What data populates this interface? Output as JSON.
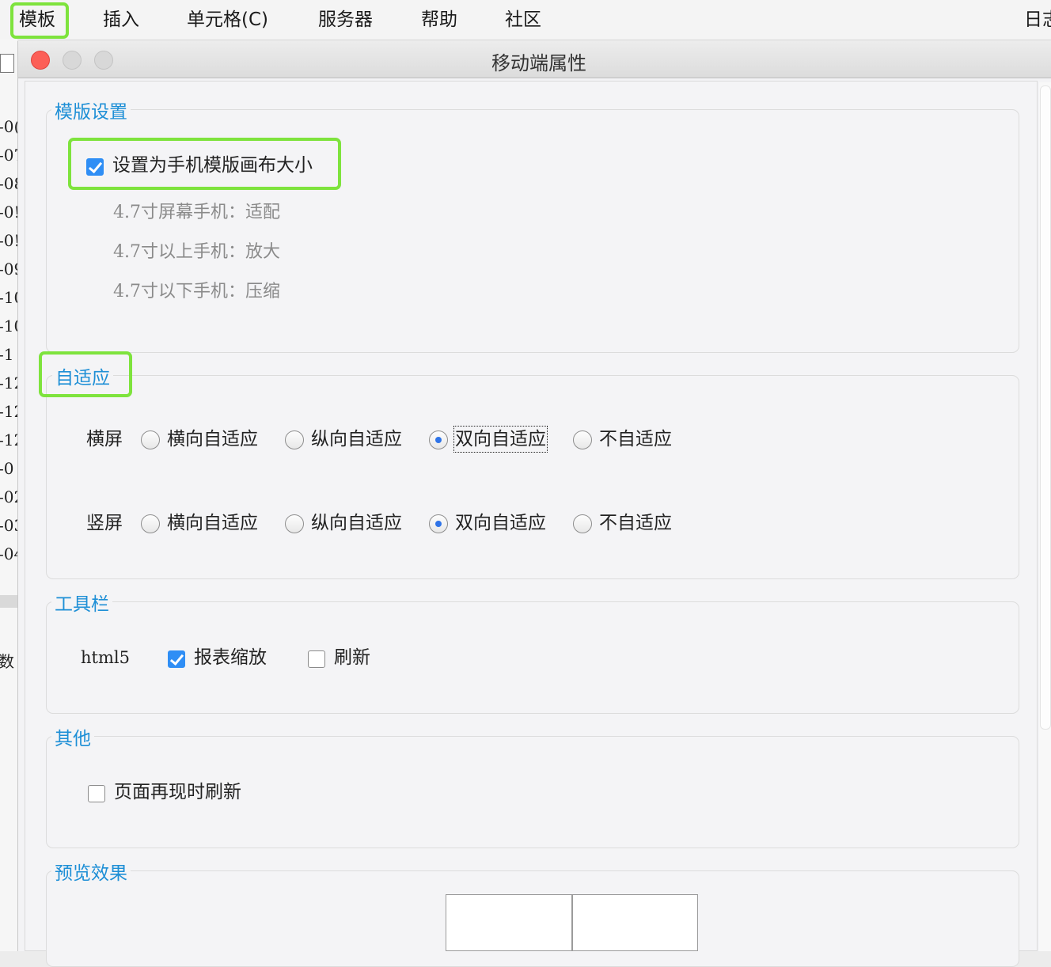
{
  "menubar": {
    "items": [
      "模板",
      "插入",
      "单元格(C)",
      "服务器",
      "帮助",
      "社区"
    ],
    "right": "日志"
  },
  "background": {
    "row_labels": [
      "-0(",
      "-07",
      "-08",
      "-0!",
      "-0!",
      "-09",
      "-10",
      "-10",
      "-1",
      "-12",
      "-12",
      "-12",
      "-0",
      "-02",
      "-03",
      "-04"
    ],
    "bottom_label": "数"
  },
  "dialog": {
    "title": "移动端属性",
    "template_settings": {
      "legend": "模版设置",
      "checkbox_label": "设置为手机模版画布大小",
      "checked": true,
      "notes": [
        "4.7寸屏幕手机：适配",
        "4.7寸以上手机：放大",
        "4.7寸以下手机：压缩"
      ]
    },
    "adaptive": {
      "legend": "自适应",
      "options": [
        "横向自适应",
        "纵向自适应",
        "双向自适应",
        "不自适应"
      ],
      "rows": [
        {
          "label": "横屏",
          "selected": "双向自适应"
        },
        {
          "label": "竖屏",
          "selected": "双向自适应"
        }
      ]
    },
    "toolbar": {
      "legend": "工具栏",
      "label": "html5",
      "zoom_label": "报表缩放",
      "zoom_checked": true,
      "refresh_label": "刷新",
      "refresh_checked": false
    },
    "other": {
      "legend": "其他",
      "checkbox_label": "页面再现时刷新",
      "checked": false
    },
    "preview": {
      "legend": "预览效果"
    }
  },
  "colors": {
    "highlight": "#7ee33d",
    "legend": "#1e8fd6",
    "checkbox_checked": "#2f8ef5",
    "close_button": "#fc5f57"
  }
}
